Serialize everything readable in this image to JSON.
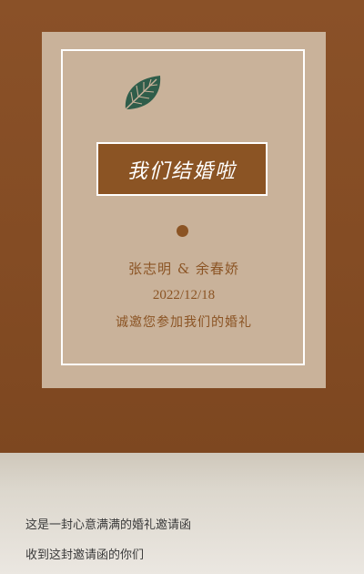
{
  "card": {
    "title": "我们结婚啦",
    "names": "张志明 & 余春娇",
    "date": "2022/12/18",
    "invite": "诚邀您参加我们的婚礼",
    "leaf_icon": "leaf-icon"
  },
  "message": {
    "lines": [
      "这是一封心意满满的婚礼邀请函",
      "收到这封邀请函的你们"
    ]
  },
  "colors": {
    "brown": "#8b5424",
    "card": "#c9b29a",
    "leaf": "#2f5d4a"
  }
}
